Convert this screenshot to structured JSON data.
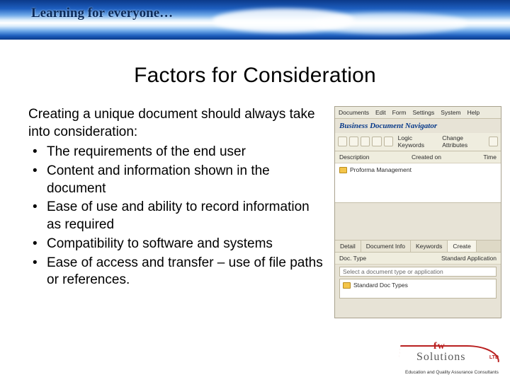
{
  "banner": {
    "tagline": "Learning for everyone…"
  },
  "title": "Factors for Consideration",
  "intro": "Creating a unique document should always take into consideration:",
  "bullets": [
    "The requirements of the end user",
    "Content and information shown in the document",
    "Ease of use and ability to record information as required",
    "Compatibility to software and systems",
    "Ease of access and transfer – use of file paths or references."
  ],
  "app": {
    "menu": [
      "Documents",
      "Edit",
      "Form",
      "Settings",
      "System",
      "Help"
    ],
    "subtitle": "Business Document Navigator",
    "toolbar": {
      "btn1": "Logic Keywords",
      "btn2": "Change Attributes"
    },
    "row1": {
      "left": "Description",
      "mid": "Created on",
      "right": "Time"
    },
    "tree1": "Proforma Management",
    "tabs": [
      "Detail",
      "Document Info",
      "Keywords",
      "Create"
    ],
    "row2": {
      "left": "Doc. Type",
      "right": "Standard Application"
    },
    "select_placeholder": "Select a document type or application",
    "tree2": "Standard Doc Types"
  },
  "logo": {
    "fw": "fw",
    "solutions": "Solutions",
    "ltd": "LTD",
    "sub": "Education and Quality Assurance Consultants"
  }
}
